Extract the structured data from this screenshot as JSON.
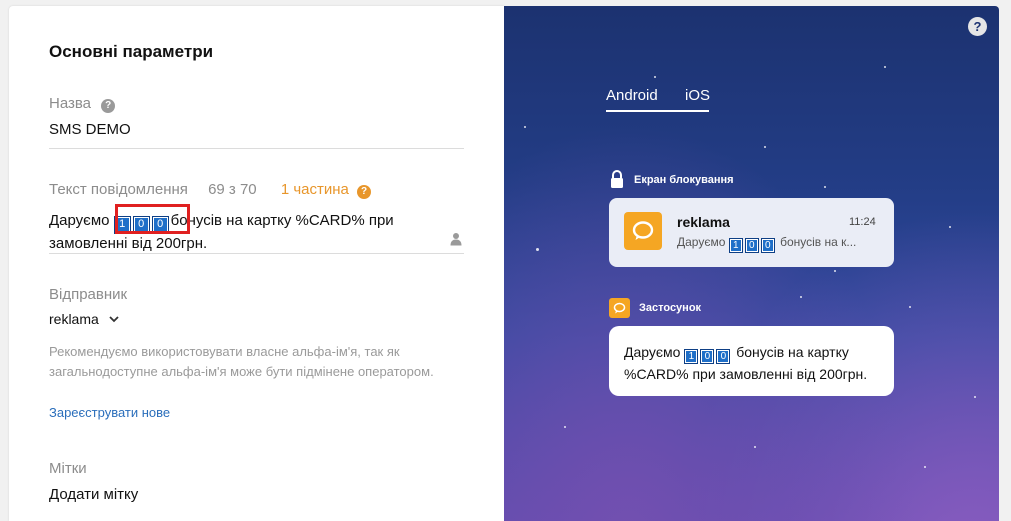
{
  "form": {
    "section_title": "Основні параметри",
    "name": {
      "label": "Назва",
      "value": "SMS DEMO"
    },
    "message": {
      "label": "Текст повідомлення",
      "counter_current": "69",
      "counter_sep": "з 70",
      "parts": "1 частина",
      "text_before": "Даруємо ",
      "digits": [
        "1",
        "0",
        "0"
      ],
      "text_line1_after": "бонусів на картку %CARD% при",
      "text_line2": "замовленні від 200грн."
    },
    "sender": {
      "label": "Відправник",
      "value": "reklama",
      "hint": "Рекомендуємо використовувати власне альфа-ім'я, так як загальнодоступне альфа-ім'я може бути підмінене оператором.",
      "register_link": "Зареєструвати нове"
    },
    "tags": {
      "label": "Мітки",
      "add_label": "Додати мітку"
    }
  },
  "preview": {
    "tabs": [
      {
        "label": "Android",
        "active": true
      },
      {
        "label": "iOS",
        "active": false
      }
    ],
    "lock_screen": {
      "label": "Екран блокування",
      "app_name": "reklama",
      "time": "11:24",
      "text_before": "Даруємо ",
      "digits": [
        "1",
        "0",
        "0"
      ],
      "text_after": "бонусів на к..."
    },
    "app": {
      "label": "Застосунок",
      "text_before": "Даруємо ",
      "digits": [
        "1",
        "0",
        "0"
      ],
      "text_line1_after": "бонусів на картку",
      "text_line2": "%CARD% при замовленні від 200грн."
    }
  },
  "colors": {
    "accent_orange": "#e8962b",
    "link_blue": "#2a6ebb",
    "highlight_red": "#e02020"
  }
}
